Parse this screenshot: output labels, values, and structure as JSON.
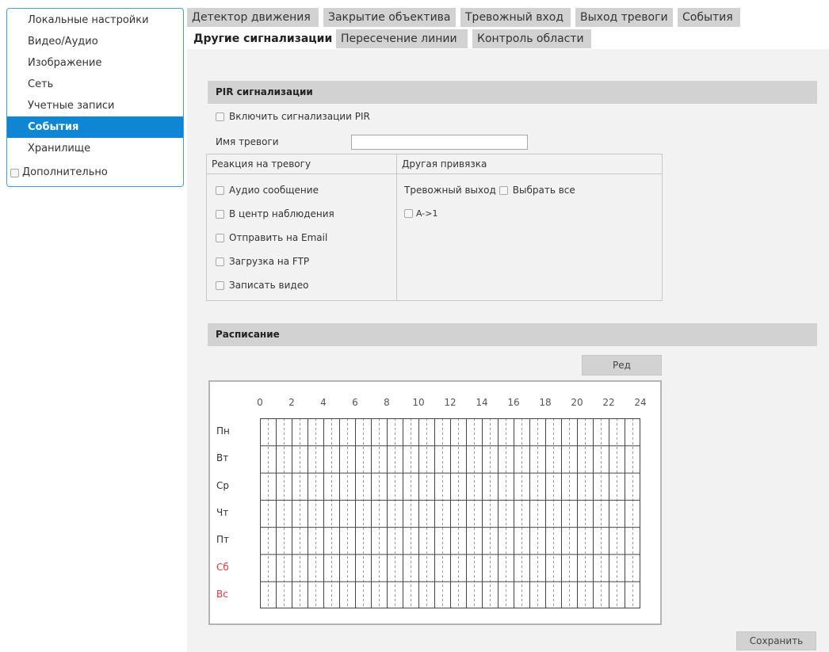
{
  "sidebar": {
    "items": [
      {
        "label": "Локальные настройки"
      },
      {
        "label": "Видео/Аудио"
      },
      {
        "label": "Изображение"
      },
      {
        "label": "Сеть"
      },
      {
        "label": "Учетные записи"
      },
      {
        "label": "События",
        "active": true
      },
      {
        "label": "Хранилище"
      }
    ],
    "advanced_label": "Дополнительно"
  },
  "tabs": {
    "row1": [
      "Детектор движения",
      "Закрытие объектива",
      "Тревожный вход",
      "Выход тревоги",
      "События"
    ],
    "row2": [
      "Другие сигнализации",
      "Пересечение линии",
      "Контроль области"
    ],
    "active": "Другие сигнализации"
  },
  "pir": {
    "section_title": "PIR сигнализации",
    "enable_label": "Включить сигнализации PIR",
    "alarm_name_label": "Имя тревоги",
    "alarm_name_value": "",
    "reaction_header": "Реакция на тревогу",
    "linkage_header": "Другая привязка",
    "reactions": [
      "Аудио сообщение",
      "В центр наблюдения",
      "Отправить на Email",
      "Загрузка на FTP",
      "Записать видео"
    ],
    "alarm_output_label": "Тревожный выход",
    "select_all_label": "Выбрать все",
    "output_item": "A->1"
  },
  "schedule": {
    "section_title": "Расписание",
    "edit_button": "Ред",
    "hours": [
      "0",
      "2",
      "4",
      "6",
      "8",
      "10",
      "12",
      "14",
      "16",
      "18",
      "20",
      "22",
      "24"
    ],
    "days": [
      "Пн",
      "Вт",
      "Ср",
      "Чт",
      "Пт",
      "Сб",
      "Вс"
    ],
    "weekend_color": "#e0393e"
  },
  "save_button": "Сохранить",
  "colors": {
    "accent": "#0f86d4",
    "tab_bg": "#d2d2d2",
    "panel_bg": "#f2f2f2"
  }
}
